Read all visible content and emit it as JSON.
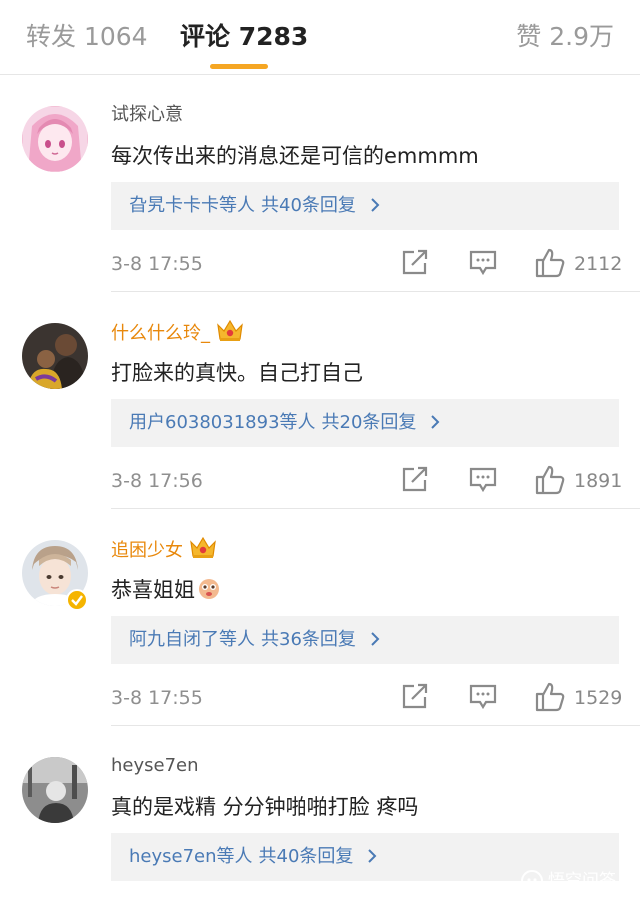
{
  "tabs": {
    "repost": "转发 1064",
    "comments": "评论 7283",
    "likes": "赞 2.9万"
  },
  "colors": {
    "accent": "#f5a623",
    "link": "#4a7ab5",
    "vip_name": "#e8880c",
    "muted": "#8f8f8f"
  },
  "comments": [
    {
      "name": "试探心意",
      "text": "每次传出来的消息还是可信的emmmm",
      "reply_who": "旮旯卡卡卡等人",
      "reply_count": "共40条回复",
      "time": "3-8 17:55",
      "likes": "2112",
      "avatar": "anime-girl-avatar"
    },
    {
      "name": "什么什么玲_",
      "text": "打脸来的真快。自己打自己",
      "reply_who": "用户6038031893等人",
      "reply_count": "共20条回复",
      "time": "3-8 17:56",
      "likes": "1891",
      "avatar": "crowd-photo-avatar"
    },
    {
      "name": "追困少女",
      "text": "恭喜姐姐",
      "reply_who": "阿九自闭了等人",
      "reply_count": "共36条回复",
      "time": "3-8 17:55",
      "likes": "1529",
      "avatar": "boy-portrait-avatar"
    },
    {
      "name": "heyse7en",
      "text": "真的是戏精 分分钟啪啪打脸 疼吗",
      "reply_who": "heyse7en等人",
      "reply_count": "共40条回复",
      "avatar": "grayscale-photo-avatar"
    }
  ],
  "watermark": "悟空问答"
}
